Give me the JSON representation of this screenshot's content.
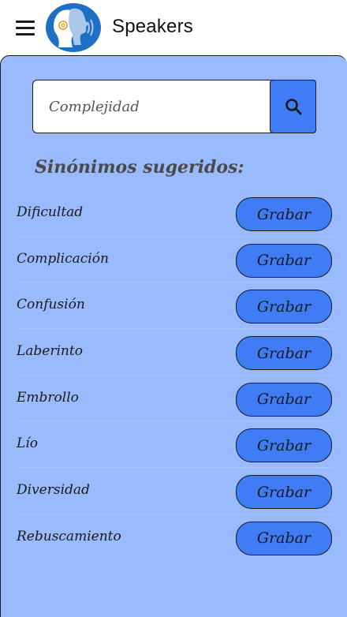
{
  "appbar": {
    "title": "Speakers",
    "menu_icon": "hamburger-menu-icon",
    "logo_icon": "speaking-head-logo"
  },
  "search": {
    "placeholder": "Complejidad",
    "button_icon": "search-icon"
  },
  "suggestions": {
    "heading": "Sinónimos sugeridos:",
    "items": [
      {
        "word": "Dificultad",
        "button": "Grabar"
      },
      {
        "word": "Complicación",
        "button": "Grabar"
      },
      {
        "word": "Confusión",
        "button": "Grabar"
      },
      {
        "word": "Laberinto",
        "button": "Grabar"
      },
      {
        "word": "Embrollo",
        "button": "Grabar"
      },
      {
        "word": "Lío",
        "button": "Grabar"
      },
      {
        "word": "Diversidad",
        "button": "Grabar"
      },
      {
        "word": "Rebuscamiento",
        "button": "Grabar"
      }
    ]
  },
  "colors": {
    "panel_background": "#99bbfd",
    "accent_button": "#3f7cf5",
    "logo_blue": "#1f6fc4"
  }
}
